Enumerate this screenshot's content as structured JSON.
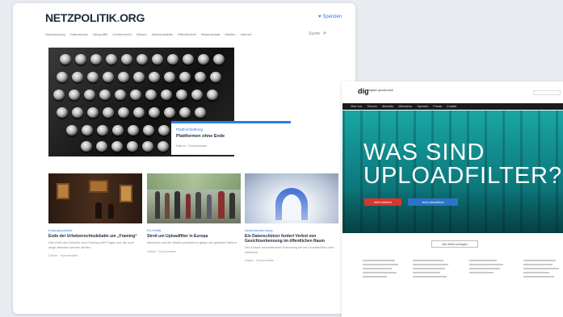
{
  "left_site": {
    "logo_main": "NETZPOLITIK",
    "logo_dot": ".",
    "logo_org": "ORG",
    "spenden_label": "♥ Spenden",
    "nav_items": [
      "Überwachung",
      "Datenschutz",
      "Netzpolitik",
      "Urheberrecht",
      "Wissen",
      "Netzneutralität",
      "Öffentlichkeit",
      "Wissenschaft",
      "Medien",
      "Internet"
    ],
    "search_placeholder": "Suche",
    "hero": {
      "kicker": "Plattformhaftung",
      "title": "Plattformen ohne Ende",
      "meta": "Datum · Kommentare"
    },
    "teasers": [
      {
        "kicker": "Kulturgeschichte",
        "title": "Ende der Urheberrechtsdebatte um „Framing“",
        "excerpt": "Das Urteil des Gerichts zum Framing wirft Fragen auf, die noch lange diskutiert werden dürften.",
        "meta": "Datum · Kommentare"
      },
      {
        "kicker": "EU-Politik",
        "title": "Streit um Uploadfilter in Europa",
        "excerpt": "Menschen auf der Straße protestieren gegen die geplante Reform.",
        "meta": "Datum · Kommentare"
      },
      {
        "kicker": "Gesichtserkennung",
        "title": "Ein Datenschützer fordert Verbot von Gesichtserkennung im öffentlichen Raum",
        "excerpt": "Der Einsatz automatisierter Erkennung sei mit Grundrechten nicht vereinbar.",
        "meta": "Datum · Kommentare"
      }
    ]
  },
  "right_site": {
    "logo": "dig",
    "logo_sub": "digitale gesellschaft",
    "nav_items": [
      "Über uns",
      "Themen",
      "Aktuelles",
      "Mitmachen",
      "Spenden",
      "Presse",
      "Kontakt"
    ],
    "headline_line1": "WAS SIND",
    "headline_line2": "UPLOADFILTER?",
    "button_red": "Mehr erfahren",
    "button_blue": "Jetzt unterstützen",
    "button_outline": "Alle Artikel anzeigen"
  },
  "colors": {
    "accent_blue": "#2b7de9",
    "teal": "#1aa6a4",
    "red": "#d9362c"
  }
}
